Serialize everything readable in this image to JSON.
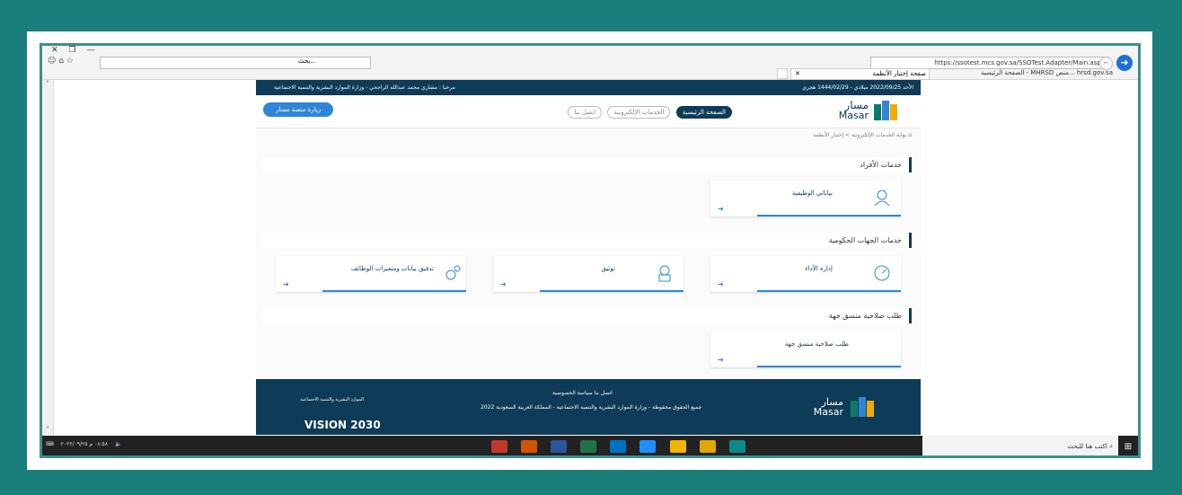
{
  "browser": {
    "address": "https://ssotest.mcs.gov.sa/SSOTest.Adapter/Main.aspx",
    "search_placeholder": "بحث...",
    "tab_active": "صفحة إختبار الأنظمة",
    "tab_other": "الصفحة الرئيسية - MHRSD منص... hrsd.gov.sa"
  },
  "infobar": {
    "date": "الأحد 2022/09/25 ميلادي - 1444/02/29 هجري",
    "user": "مرحبا : مشاري محمد عبدالله الراجحي - وزارة الموارد البشرية والتنمية الاجتماعية"
  },
  "header": {
    "logo_ar": "مسار",
    "logo_en": "Masar",
    "nav": [
      "الصفحة الرئيسية",
      "الخدمات الإلكترونية",
      "اتصل بنا"
    ],
    "visit_button": "زيارة منصة مسار"
  },
  "breadcrumb": "بوابة الخدمات الإلكترونية > إختبار الأنظمة",
  "sections": [
    {
      "title": "خدمات الأفراد",
      "cards": [
        "بياناتي الوظيفية"
      ]
    },
    {
      "title": "خدمات الجهات الحكومية",
      "cards": [
        "إدارة الأداء",
        "توثيق",
        "تدقيق بيانات ومتغيرات الوظائف"
      ]
    },
    {
      "title": "طلب صلاحية منسق جهة",
      "cards": [
        "طلب صلاحية منسق جهة"
      ]
    }
  ],
  "footer": {
    "links": "اتصل بنا   سياسة الخصوصية",
    "copyright": "جميع الحقوق محفوظة - وزارة الموارد البشرية والتنمية الاجتماعية - المملكة العربية السعودية 2022",
    "logo_ar": "مسار",
    "logo_en": "Masar",
    "gov": "الموارد البشرية والتنمية الاجتماعية",
    "vision": "VISION 2030"
  },
  "taskbar": {
    "search": "اكتب هنا للبحث",
    "clock": "٠٨:٥٨ م ٢٠٢٢/٠٩/٢٥"
  },
  "colors": {
    "primary": "#0e3b57",
    "accent": "#2f86d6",
    "frame": "#1a7f7a"
  }
}
